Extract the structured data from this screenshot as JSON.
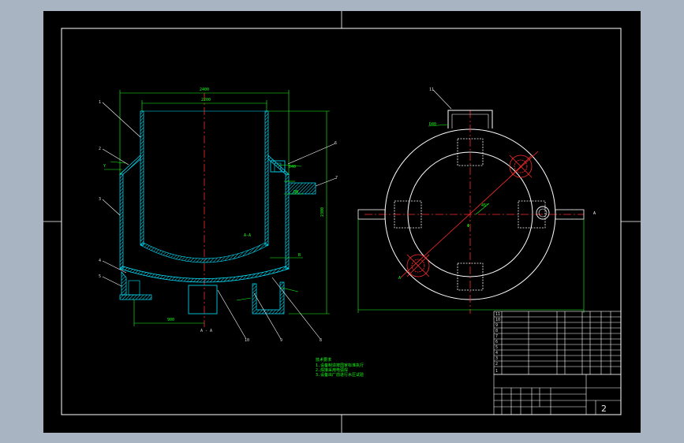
{
  "colors": {
    "background": "#a9b4c2",
    "sheet": "#000000",
    "border": "#ffffff",
    "vessel": "#00e5ff",
    "dimension": "#19ff19",
    "centerline": "#ff2a2a",
    "hidden": "#ffffff"
  },
  "icons": {
    "sheet": "drawing-sheet",
    "front_view": "vessel-section-view",
    "top_view": "vessel-plan-view",
    "title_block": "title-block-table"
  },
  "title_block": {
    "sheet_number": "2"
  }
}
